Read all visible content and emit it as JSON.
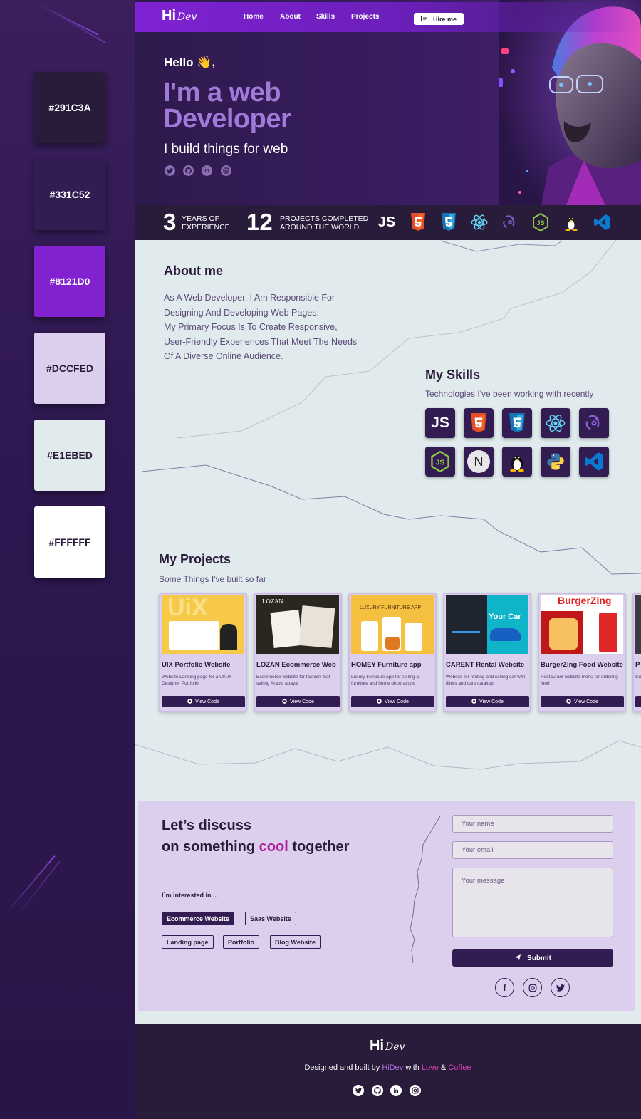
{
  "palette": [
    {
      "label": "#291C3A",
      "color": "#291C3A",
      "text_color": "#ffffff"
    },
    {
      "label": "#331C52",
      "color": "#331C52",
      "text_color": "#ffffff"
    },
    {
      "label": "#8121D0",
      "color": "#8121D0",
      "text_color": "#ffffff"
    },
    {
      "label": "#DCCFED",
      "color": "#DCCFED",
      "text_color": "#291C3A"
    },
    {
      "label": "#E1EBED",
      "color": "#E1EBED",
      "text_color": "#291C3A"
    },
    {
      "label": "#FFFFFF",
      "color": "#FFFFFF",
      "text_color": "#291C3A"
    }
  ],
  "nav": {
    "logo_main": "Hi",
    "logo_sub": "Dev",
    "links": [
      "Home",
      "About",
      "Skills",
      "Projects"
    ],
    "hire_label": "Hire me"
  },
  "hero": {
    "greeting": "Hello 👋,",
    "headline": "I'm a web Developer",
    "tagline": "I build things for web",
    "social_icons": [
      "twitter-icon",
      "github-icon",
      "linkedin-icon",
      "instagram-icon"
    ]
  },
  "stats": {
    "years_number": "3",
    "years_label_1": "YEARS OF",
    "years_label_2": "EXPERIENCE",
    "projects_number": "12",
    "projects_label_1": "PROJECTS COMPLETED",
    "projects_label_2": "AROUND THE WORLD",
    "tech_icons": [
      "javascript-icon",
      "html5-icon",
      "css3-icon",
      "react-icon",
      "redux-icon",
      "nodejs-icon",
      "linux-icon",
      "vscode-icon"
    ]
  },
  "about": {
    "title": "About me",
    "lines": [
      "As A Web Developer, I Am Responsible For",
      "Designing And Developing Web Pages.",
      "My Primary Focus Is To Create Responsive,",
      "User-Friendly Experiences That Meet The Needs",
      "Of A Diverse Online Audience."
    ]
  },
  "skills": {
    "title": "My Skills",
    "subtitle": "Technologies I've been working with recently",
    "icons": [
      "javascript-icon",
      "html5-icon",
      "css3-icon",
      "react-icon",
      "redux-icon",
      "nodejs-icon",
      "nextjs-icon",
      "linux-icon",
      "python-icon",
      "vscode-icon"
    ],
    "js_text": "JS",
    "next_text": "N"
  },
  "projects": {
    "title": "My Projects",
    "subtitle": "Some Things I've built so far",
    "items": [
      {
        "title": "UIX Portfolio Website",
        "desc": "Website Landing page for a UI/UX Designer Portfolio",
        "button": "View Code",
        "thumb_text": "UiX"
      },
      {
        "title": "LOZAN Ecommerce Web",
        "desc": "Ecommerce website for fashion that selling Arabic abaya",
        "button": "View Code",
        "thumb_text": "LOZAN"
      },
      {
        "title": "HOMEY Furniture app",
        "desc": "Luxury Furniture app for selling a furniture and home decorations",
        "button": "View Code",
        "thumb_text": "LUXURY FURNITURE APP"
      },
      {
        "title": "CARENT Rental Website",
        "desc": "Website for renting and selling car with filters and cars catalogs",
        "button": "View Code",
        "thumb_text": "Your Car"
      },
      {
        "title": "BurgerZing Food Website",
        "desc": "Restaurant website menu for ordering food",
        "button": "View Code",
        "thumb_text": "BurgerZing"
      },
      {
        "title": "P",
        "desc": "Su g",
        "button": "",
        "thumb_text": ""
      }
    ]
  },
  "contact": {
    "heading_line1": "Let’s discuss",
    "heading_pre": "on something ",
    "heading_accent": "cool",
    "heading_post": " together",
    "interest_label": "I`m interested in ..",
    "chips": [
      "Ecommerce Website",
      "Saas Website",
      "Landing page",
      "Portfolio",
      "Blog Website"
    ],
    "name_placeholder": "Your name",
    "email_placeholder": "Your email",
    "message_placeholder": "Your message",
    "submit_label": "Submit",
    "social_icons": [
      "facebook-icon",
      "instagram-icon",
      "twitter-icon"
    ]
  },
  "footer": {
    "credit_pre": "Designed and built by ",
    "credit_name": "HiDev",
    "credit_mid": " with ",
    "credit_love": "Love",
    "credit_amp": " & ",
    "credit_coffee": "Coffee",
    "accent_color": "#b070e0",
    "love_color": "#e040b0",
    "social_icons": [
      "twitter-icon",
      "github-icon",
      "linkedin-icon",
      "instagram-icon"
    ]
  }
}
